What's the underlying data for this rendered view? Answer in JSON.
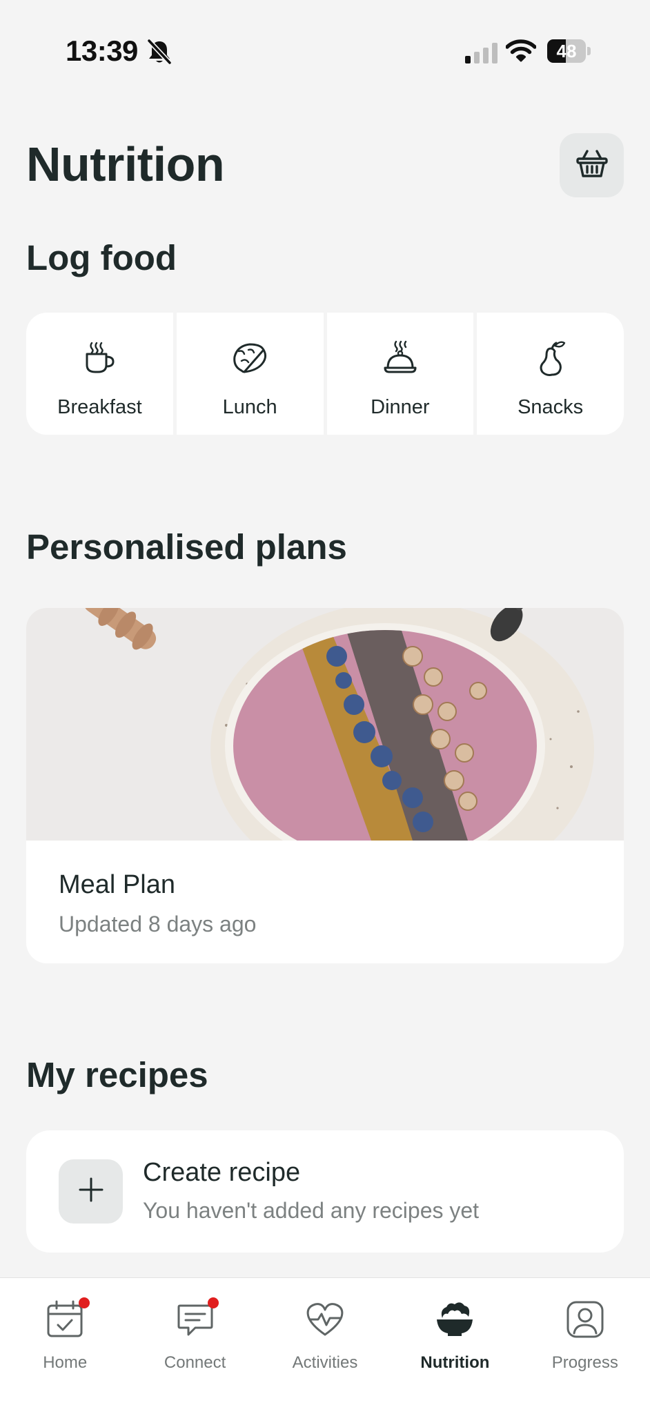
{
  "status_bar": {
    "time": "13:39",
    "battery": "48",
    "battery_level": 0.48,
    "icons": [
      "bell-slash-icon",
      "cellular-signal-icon",
      "wifi-icon",
      "battery-icon"
    ]
  },
  "header": {
    "title": "Nutrition",
    "basket_icon": "basket-icon"
  },
  "log_food": {
    "title": "Log food",
    "items": [
      {
        "label": "Breakfast",
        "icon": "coffee-cup-icon"
      },
      {
        "label": "Lunch",
        "icon": "taco-icon"
      },
      {
        "label": "Dinner",
        "icon": "cloche-icon"
      },
      {
        "label": "Snacks",
        "icon": "pear-icon"
      }
    ]
  },
  "plans": {
    "title": "Personalised plans",
    "card": {
      "name": "Meal Plan",
      "updated": "Updated 8 days ago"
    }
  },
  "recipes": {
    "title": "My recipes",
    "create_title": "Create recipe",
    "create_sub": "You haven't added any recipes yet"
  },
  "tabs": [
    {
      "label": "Home",
      "icon": "calendar-check-icon",
      "badge": true,
      "active": false
    },
    {
      "label": "Connect",
      "icon": "chat-icon",
      "badge": true,
      "active": false
    },
    {
      "label": "Activities",
      "icon": "heart-pulse-icon",
      "badge": false,
      "active": false
    },
    {
      "label": "Nutrition",
      "icon": "salad-bowl-icon",
      "badge": false,
      "active": true
    },
    {
      "label": "Progress",
      "icon": "profile-icon",
      "badge": false,
      "active": false
    }
  ],
  "colors": {
    "background": "#f4f4f4",
    "text": "#1f2a2a",
    "muted": "#7c8181",
    "badge": "#e01e1e"
  }
}
